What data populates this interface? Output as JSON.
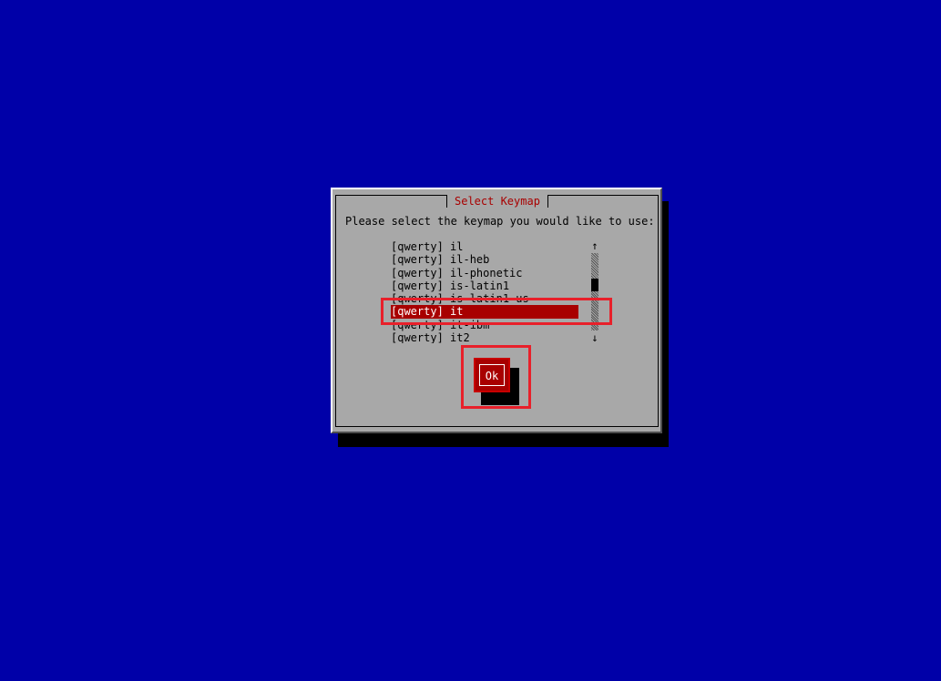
{
  "dialog": {
    "title": "Select Keymap",
    "prompt": "Please select the keymap you would like to use:"
  },
  "keymap_list": {
    "items": [
      {
        "label": "[qwerty] il",
        "selected": false
      },
      {
        "label": "[qwerty] il-heb",
        "selected": false
      },
      {
        "label": "[qwerty] il-phonetic",
        "selected": false
      },
      {
        "label": "[qwerty] is-latin1",
        "selected": false
      },
      {
        "label": "[qwerty] is-latin1-us",
        "selected": false
      },
      {
        "label": "[qwerty] it",
        "selected": true
      },
      {
        "label": "[qwerty] it-ibm",
        "selected": false
      },
      {
        "label": "[qwerty] it2",
        "selected": false
      }
    ],
    "selected_value": "[qwerty] it",
    "scroll_up_glyph": "↑",
    "scroll_down_glyph": "↓"
  },
  "buttons": {
    "ok_label": "Ok"
  },
  "colors": {
    "desktop_background": "#0000a8",
    "dialog_background": "#a8a8a8",
    "title_text": "#a80000",
    "selection_background": "#a80000",
    "selection_text": "#ffffff",
    "annotation_highlight": "#e8202a"
  }
}
